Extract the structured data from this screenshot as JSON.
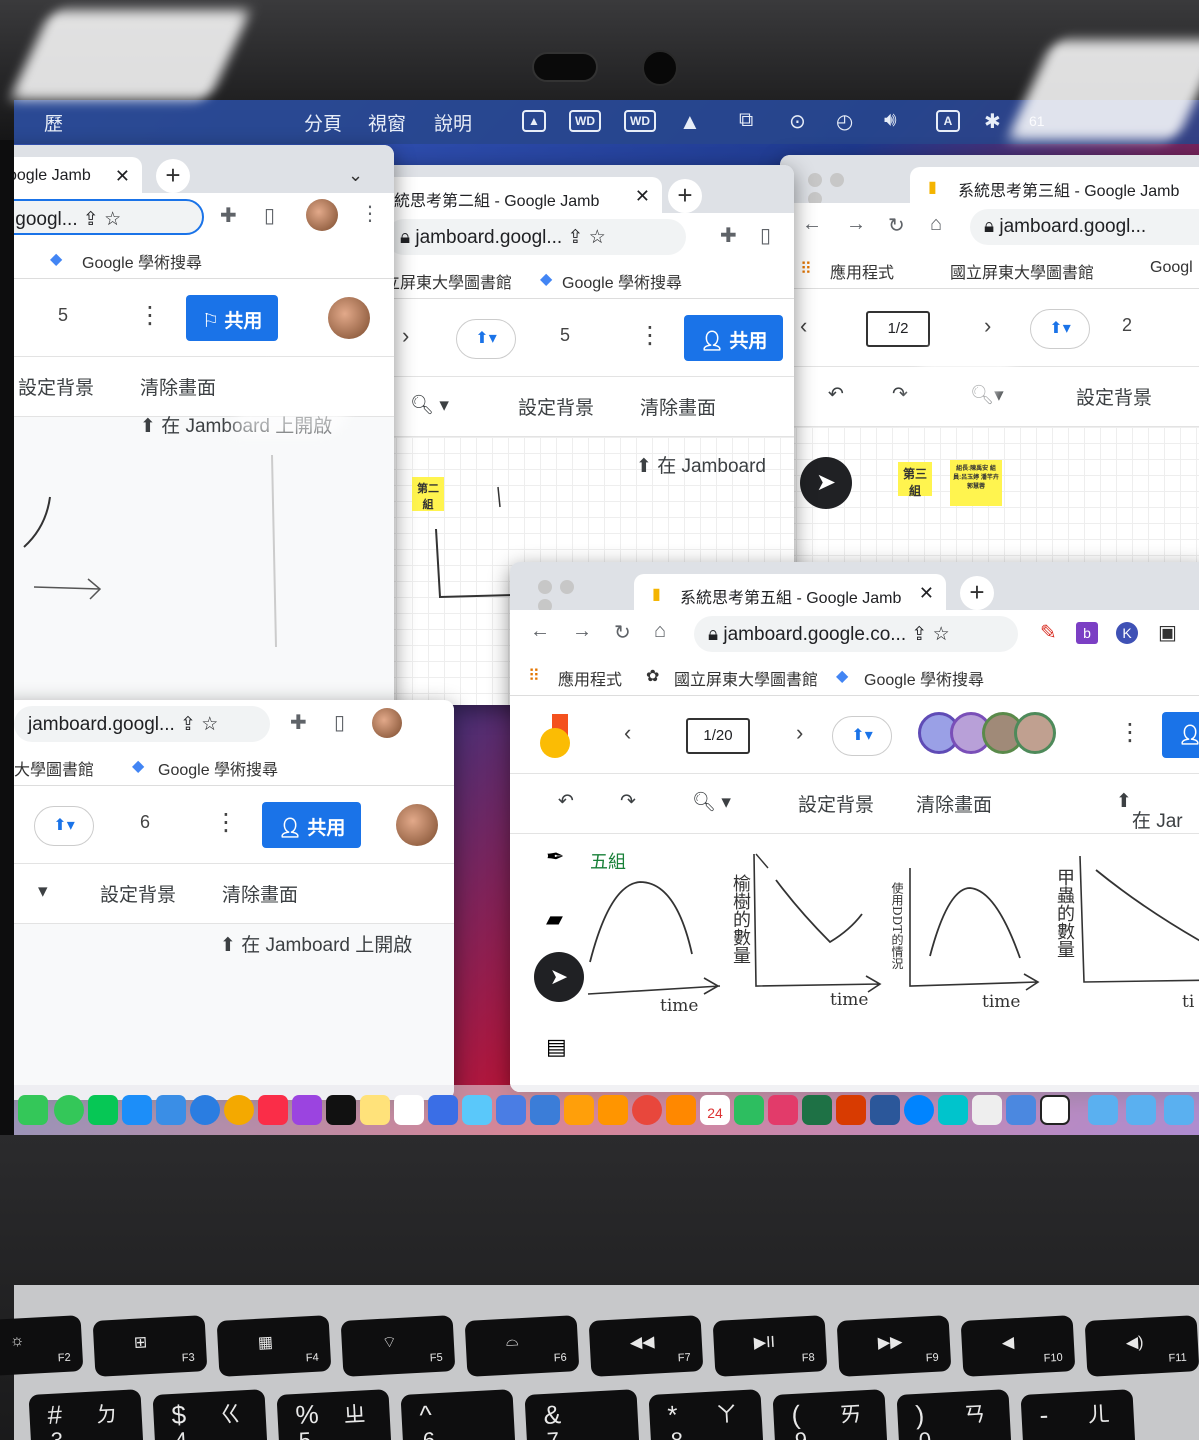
{
  "menubar": {
    "items": [
      "歷",
      "分頁",
      "視窗",
      "說明"
    ],
    "status_text": "61"
  },
  "window_top_left": {
    "tab_title": "oogle Jamb",
    "address": ".googl...",
    "bookmark": "Google 學術搜尋",
    "page_count": "5",
    "share_label": "共用",
    "tool_set_bg": "設定背景",
    "tool_clear": "清除畫面",
    "open_in": "在 Jamboard 上開啟"
  },
  "window_group2": {
    "tab_title": "系統思考第二組 - Google Jamb",
    "address": "jamboard.googl...",
    "bookmarks": [
      "立屏東大學圖書館",
      "Google 學術搜尋"
    ],
    "page_count": "5",
    "share_label": "共用",
    "tool_set_bg": "設定背景",
    "tool_clear": "清除畫面",
    "open_in": "在 Jamboard",
    "sticky_label": "第二組"
  },
  "window_group3": {
    "tab_title": "系統思考第三組 - Google Jamb",
    "address": "jamboard.googl...",
    "bookmarks": [
      "應用程式",
      "國立屏東大學圖書館",
      "Googl"
    ],
    "frame": "1/2",
    "page_count": "2",
    "tool_set_bg": "設定背景",
    "sticky_label": "第三組",
    "sticky_members": "組長:陳禹安 組員:呂玉婷 潘芊卉 郭慧蓉"
  },
  "window_bottom_left": {
    "address": "jamboard.googl...",
    "bookmarks": [
      "大學圖書館",
      "Google 學術搜尋"
    ],
    "page_count": "6",
    "share_label": "共用",
    "tool_set_bg": "設定背景",
    "tool_clear": "清除畫面",
    "open_in": "在 Jamboard 上開啟"
  },
  "window_group5": {
    "tab_title": "系統思考第五組 - Google Jamb",
    "address": "jamboard.google.co...",
    "bookmarks": [
      "應用程式",
      "國立屏東大學圖書館",
      "Google 學術搜尋"
    ],
    "frame": "1/20",
    "tool_set_bg": "設定背景",
    "tool_clear": "清除畫面",
    "open_in": "在 Jar",
    "canvas_group": "五組",
    "graph_labels": {
      "y1": "榆樹的數量",
      "y2": "使用DDT的情況",
      "y3": "甲蟲的數量",
      "x1": "time",
      "x2": "time",
      "x3": "time",
      "x4": "ti"
    }
  },
  "dock": {
    "calendar_day": "24"
  },
  "keyboard": {
    "fkeys": [
      "F2",
      "F3",
      "F4",
      "F5",
      "F6",
      "F7",
      "F8",
      "F9",
      "F10",
      "F11"
    ],
    "numrow": [
      "#",
      "$",
      "%",
      "^",
      "&",
      "*",
      "(",
      ")",
      "-"
    ],
    "zhuyin": [
      "ㄉ",
      "ㄍ",
      "ㄓ",
      "",
      "",
      "ㄚ",
      "ㄞ",
      "ㄢ",
      "ㄦ"
    ],
    "digits": [
      "3",
      "4",
      "5",
      "6",
      "7",
      "8",
      "9",
      "0",
      "-"
    ]
  },
  "colors": {
    "share_blue": "#1a73e8",
    "sticky_yellow": "#fff44f"
  }
}
